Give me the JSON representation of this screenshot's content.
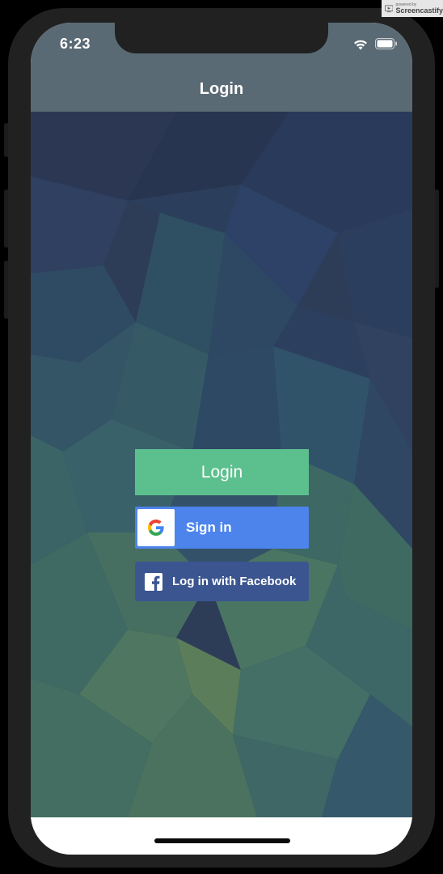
{
  "status_bar": {
    "time": "6:23"
  },
  "nav": {
    "title": "Login"
  },
  "buttons": {
    "login_label": "Login",
    "google_label": "Sign in",
    "facebook_label": "Log in with Facebook"
  },
  "watermark": {
    "small_text": "powered by",
    "name": "Screencastify"
  },
  "colors": {
    "login_green": "#5cc08e",
    "google_blue": "#4c84ec",
    "facebook_blue": "#3b5590",
    "nav_gray": "#5a6a74"
  },
  "icons": [
    "wifi-icon",
    "battery-icon",
    "google-logo-icon",
    "facebook-icon",
    "screencastify-icon"
  ]
}
